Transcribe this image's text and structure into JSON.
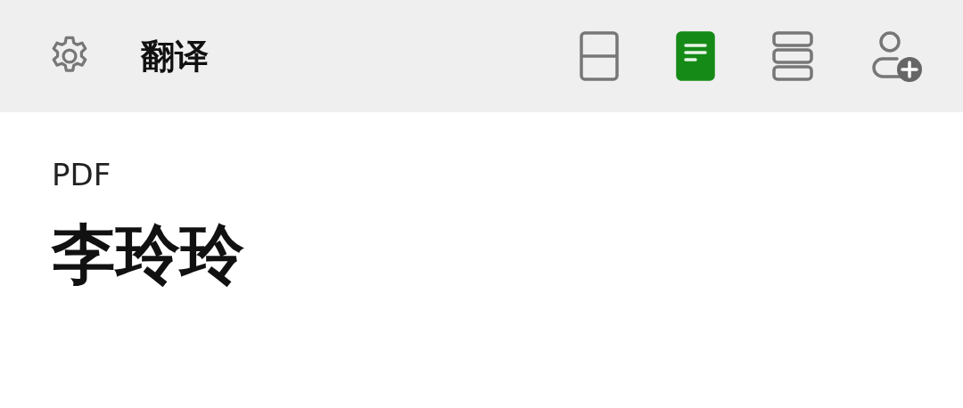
{
  "toolbar": {
    "title": "翻译",
    "view_modes": [
      {
        "kind": "split",
        "selected": false
      },
      {
        "kind": "document",
        "selected": true
      },
      {
        "kind": "list",
        "selected": false
      }
    ]
  },
  "content": {
    "label": "PDF",
    "name": "李玲玲"
  }
}
